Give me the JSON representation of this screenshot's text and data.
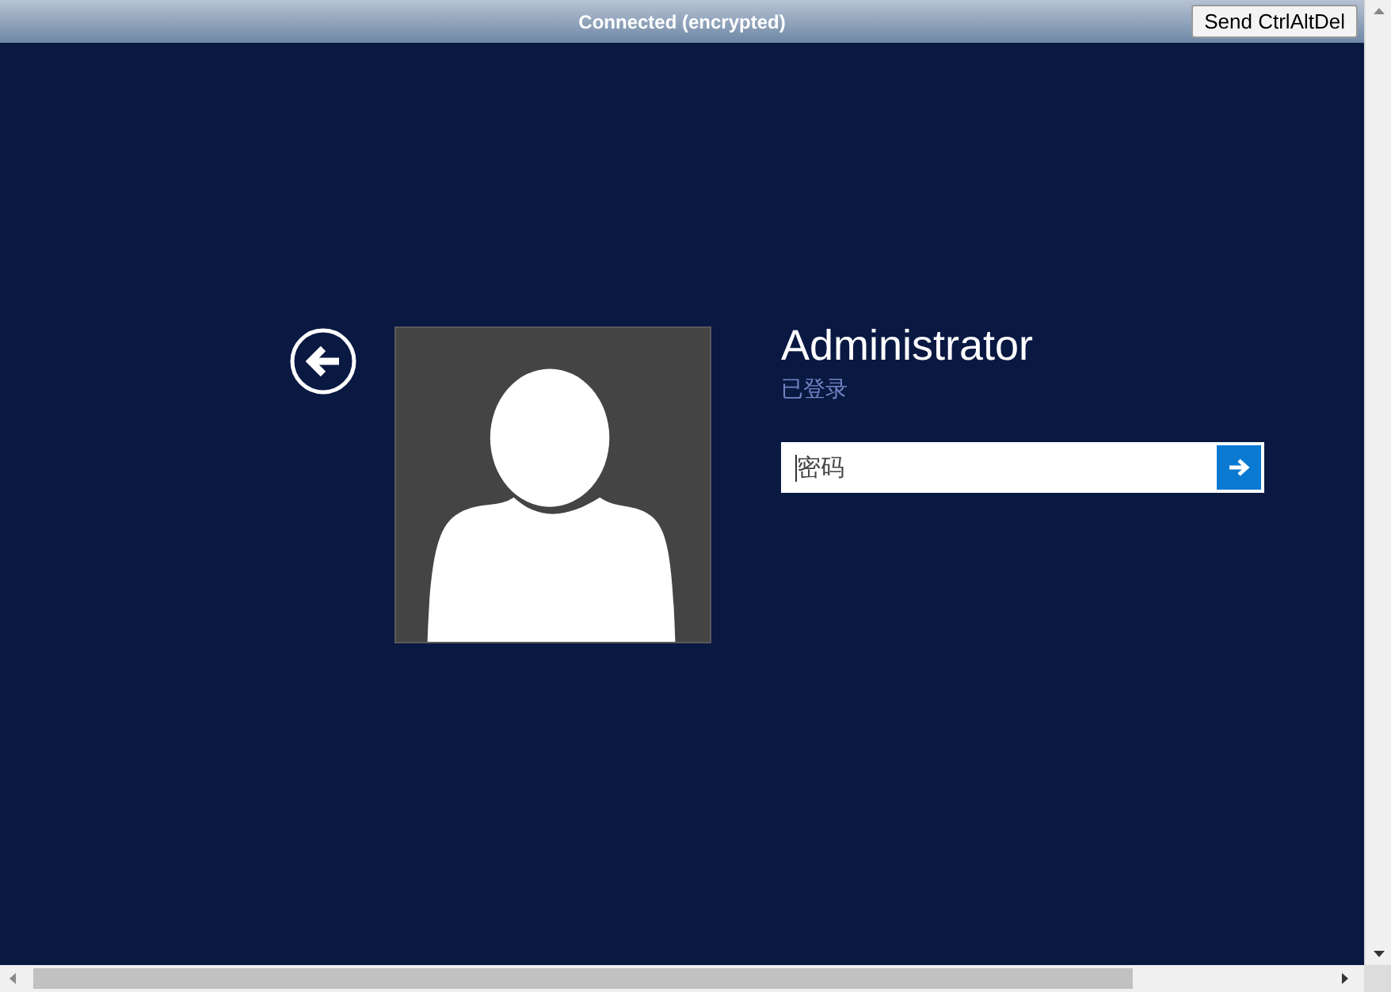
{
  "toolbar": {
    "status": "Connected (encrypted)",
    "button": "Send CtrlAltDel"
  },
  "login": {
    "user_name": "Administrator",
    "user_status": "已登录",
    "password": {
      "placeholder": "密码",
      "focused": true
    }
  }
}
